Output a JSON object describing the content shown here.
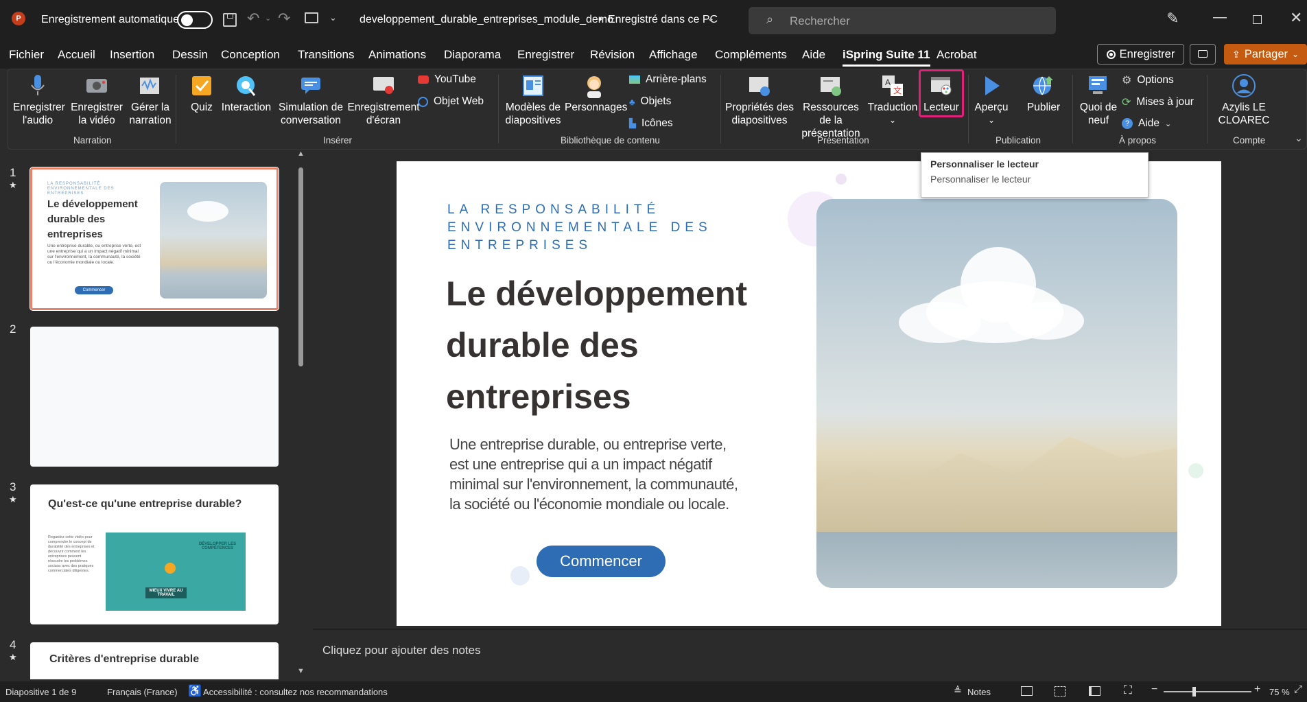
{
  "titlebar": {
    "autosave_label": "Enregistrement automatique",
    "filename": "developpement_durable_entreprises_module_demo",
    "separator": "•",
    "save_status": "Enregistré dans ce PC",
    "search_placeholder": "Rechercher"
  },
  "tabs": [
    {
      "label": "Fichier"
    },
    {
      "label": "Accueil"
    },
    {
      "label": "Insertion"
    },
    {
      "label": "Dessin"
    },
    {
      "label": "Conception"
    },
    {
      "label": "Transitions"
    },
    {
      "label": "Animations"
    },
    {
      "label": "Diaporama"
    },
    {
      "label": "Enregistrer"
    },
    {
      "label": "Révision"
    },
    {
      "label": "Affichage"
    },
    {
      "label": "Compléments"
    },
    {
      "label": "Aide"
    },
    {
      "label": "iSpring Suite 11"
    },
    {
      "label": "Acrobat"
    }
  ],
  "record_button": "Enregistrer",
  "share_button": "Partager",
  "ribbon": {
    "narration": {
      "label": "Narration",
      "record_audio": "Enregistrer l'audio",
      "record_video": "Enregistrer la vidéo",
      "manage_narration": "Gérer la narration"
    },
    "insert": {
      "label": "Insérer",
      "quiz": "Quiz",
      "interaction": "Interaction",
      "simulation": "Simulation de conversation",
      "screen_record": "Enregistrement d'écran",
      "youtube": "YouTube",
      "web_object": "Objet Web"
    },
    "library": {
      "label": "Bibliothèque de contenu",
      "templates": "Modèles de diapositives",
      "characters": "Personnages",
      "backgrounds": "Arrière-plans",
      "objects": "Objets",
      "icons": "Icônes"
    },
    "presentation": {
      "label": "Présentation",
      "slide_props": "Propriétés des diapositives",
      "resources": "Ressources de la présentation",
      "translation": "Traduction",
      "player": "Lecteur"
    },
    "publication": {
      "label": "Publication",
      "preview": "Aperçu",
      "publish": "Publier"
    },
    "about": {
      "label": "À propos",
      "whats_new": "Quoi de neuf",
      "options": "Options",
      "updates": "Mises à jour",
      "help": "Aide"
    },
    "account": {
      "label": "Compte",
      "user": "Azylis LE CLOAREC"
    }
  },
  "tooltip": {
    "title": "Personnaliser le lecteur",
    "body": "Personnaliser le lecteur"
  },
  "thumbnails": [
    {
      "num": "1",
      "star": "★",
      "eyebrow": "LA RESPONSABILITÉ ENVIRONNEMENTALE DES ENTREPRISES",
      "title": "Le développement durable des entreprises",
      "body": "Une entreprise durable, ou entreprise verte, est une entreprise qui a un impact négatif minimal sur l'environnement, la communauté, la société ou l'économie mondiale ou locale.",
      "button": "Commencer"
    },
    {
      "num": "2",
      "star": ""
    },
    {
      "num": "3",
      "star": "★",
      "title": "Qu'est-ce qu'une entreprise durable?",
      "body": "Regardez cette vidéo pour comprendre le concept de durabilité des entreprises et découvrir comment les entreprises peuvent résoudre les problèmes sociaux avec des pratiques commerciales diligentes.",
      "banner1": "DÉVELOPPER LES COMPÉTENCES",
      "banner2": "MIEUX VIVRE AU TRAVAIL"
    },
    {
      "num": "4",
      "star": "★",
      "title": "Critères d'entreprise durable"
    }
  ],
  "slide": {
    "eyebrow_line1": "LA RESPONSABILITÉ",
    "eyebrow_line2": "ENVIRONNEMENTALE DES",
    "eyebrow_line3": "ENTREPRISES",
    "title_line1": "Le développement",
    "title_line2": "durable des",
    "title_line3": "entreprises",
    "body_line1": "Une entreprise durable, ou entreprise verte,",
    "body_line2": "est une entreprise qui a un impact négatif",
    "body_line3": "minimal sur l'environnement, la communauté,",
    "body_line4": "la société ou l'économie mondiale ou locale.",
    "button": "Commencer"
  },
  "notes_placeholder": "Cliquez pour ajouter des notes",
  "status": {
    "slide_info": "Diapositive 1 de 9",
    "language": "Français (France)",
    "accessibility": "Accessibilité : consultez nos recommandations",
    "notes": "Notes",
    "zoom": "75 %"
  },
  "colors": {
    "accent": "#b7472a",
    "ispring_highlight": "#e0217a",
    "slide_blue": "#2e6db4",
    "share_orange": "#c55a11"
  }
}
